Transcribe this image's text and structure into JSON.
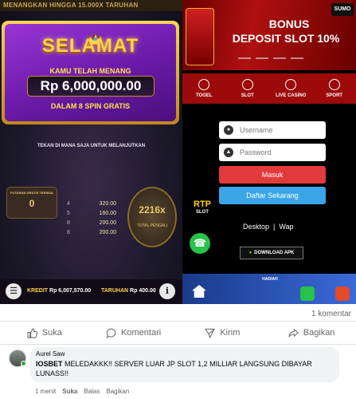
{
  "game": {
    "top_text": "MENANGKAN HINGGA 15.000X TARUHAN",
    "win_title": "SELAMAT",
    "win_message": "KAMU TELAH MENANG",
    "win_amount": "Rp 6,000,000.00",
    "spin_message": "DALAM 8 SPIN GRATIS",
    "tap_continue": "TEKAN DI MANA SAJA UNTUK MELANJUTKAN",
    "free_spins_label": "PUTARAN GRATIS TERSISA",
    "free_spins_value": "0",
    "paytable": [
      {
        "key": "4",
        "value": "320.00"
      },
      {
        "key": "5",
        "value": "160.00"
      },
      {
        "key": "8",
        "value": "200.00"
      },
      {
        "key": "8",
        "value": "200.00"
      }
    ],
    "total_value": "2216x",
    "total_label": "TOTAL PENGALI",
    "credit_label": "KREDIT",
    "credit_value": "Rp 6,007,570.00",
    "bet_label": "TARUHAN",
    "bet_value": "Rp 400.00"
  },
  "site": {
    "logo": "SUMO",
    "banner_title": "BONUS",
    "banner_subtitle": "DEPOSIT SLOT 10%",
    "nav": [
      "TOGEL",
      "SLOT",
      "LIVE CASINO",
      "SPORT"
    ],
    "username_placeholder": "Username",
    "password_placeholder": "Password",
    "login_label": "Masuk",
    "register_label": "Daftar Sekarang",
    "rtp_label": "RTP",
    "rtp_sub": "SLOT",
    "desktop_link": "Desktop",
    "wap_link": "Wap",
    "download_label": "DOWNLOAD APK",
    "strip_label": "HADIAH"
  },
  "facebook": {
    "comment_count": "1 komentar",
    "actions": [
      "Suka",
      "Komentari",
      "Kirim",
      "Bagikan"
    ],
    "comment": {
      "author": "Aurel Saw",
      "brand": "IOSBET",
      "text": " MELEDAKKK!! SERVER LUAR JP SLOT 1,2 MILLIAR LANGSUNG DIBAYAR LUNASS!!",
      "time": "1 menit",
      "like": "Suka",
      "reply": "Balas",
      "share": "Bagikan"
    }
  }
}
